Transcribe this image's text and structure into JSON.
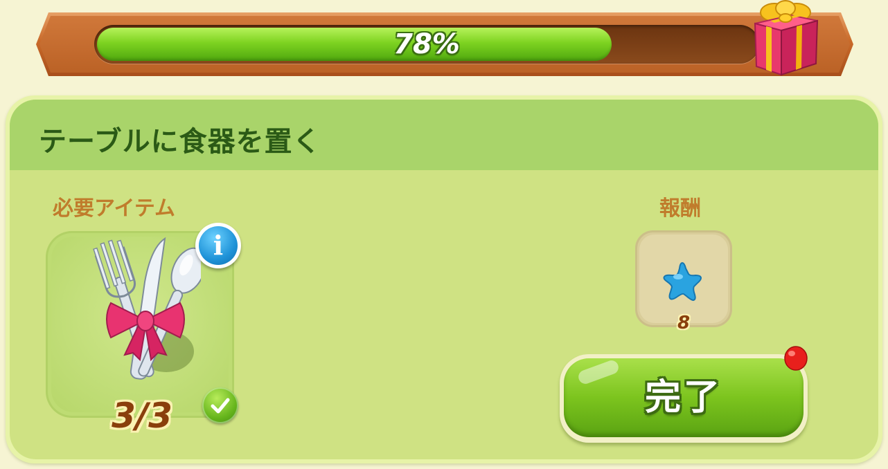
{
  "progress": {
    "label": "78%",
    "value_percent": 78,
    "reward_icon": "gift-box-icon"
  },
  "quest": {
    "title": "テーブルに食器を置く",
    "required_section_label": "必要アイテム",
    "required_item": {
      "icon": "cutlery-with-bow-icon",
      "count_label": "3/3",
      "completed": true,
      "info_label": "i"
    },
    "reward_section_label": "報酬",
    "reward": {
      "icon": "blue-star-icon",
      "amount": "8"
    },
    "complete_button_label": "完了",
    "complete_button_has_notification": true
  },
  "colors": {
    "background": "#f6f4d3",
    "panel": "#cfe283",
    "header": "#a9d46a",
    "title_text": "#2b5a16",
    "section_label": "#c07c2c",
    "progress_fill": "#7ed321",
    "banner": "#c96a2a",
    "count_text": "#8a3f0c"
  }
}
